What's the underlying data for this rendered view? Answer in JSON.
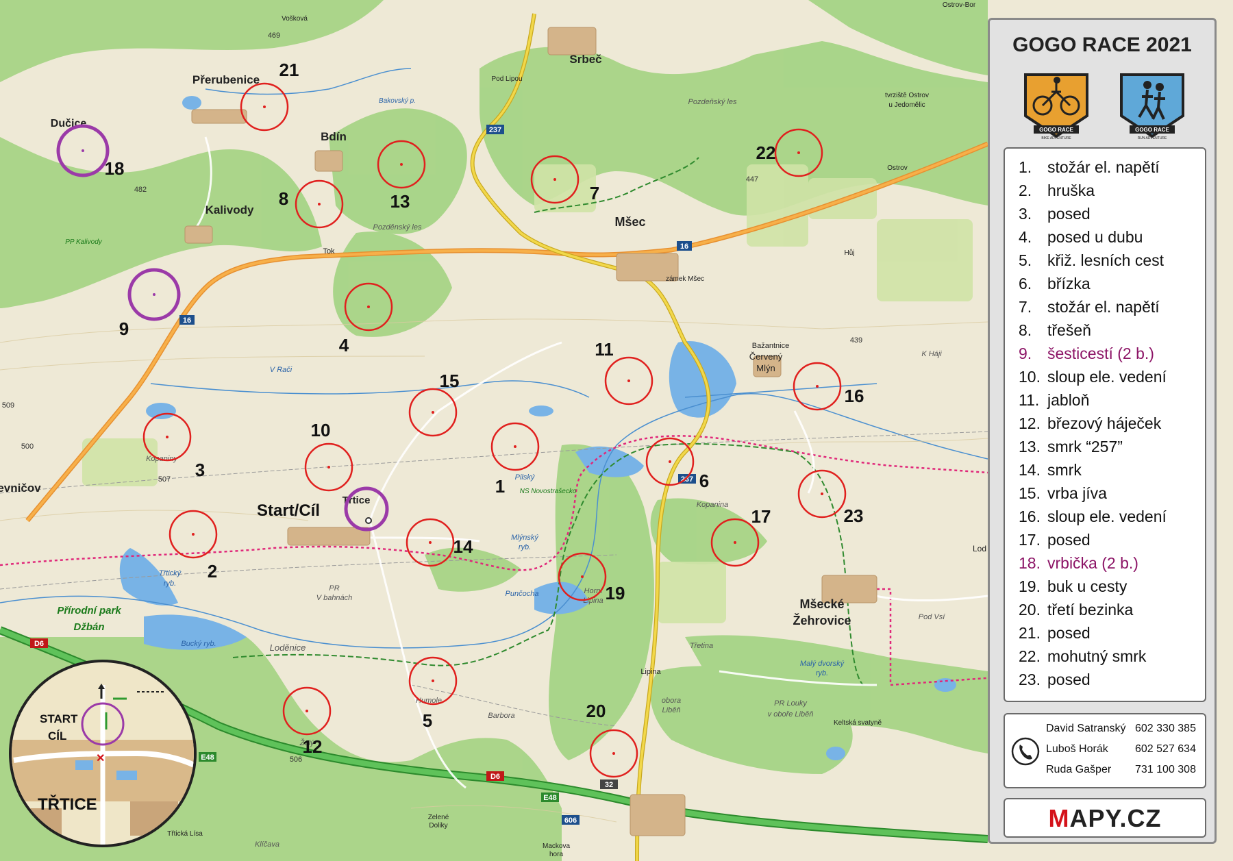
{
  "panel": {
    "title": "GOGO RACE 2021",
    "logo_bike_text": "GOGO RACE",
    "logo_bike_sub": "BIKE ADVENTURE",
    "logo_run_text": "GOGO RACE",
    "logo_run_sub": "RUN ADVENTURE",
    "legend": [
      {
        "num": "1.",
        "label": "stožár el. napětí",
        "special": false
      },
      {
        "num": "2.",
        "label": "hruška",
        "special": false
      },
      {
        "num": "3.",
        "label": "posed",
        "special": false
      },
      {
        "num": "4.",
        "label": "posed u dubu",
        "special": false
      },
      {
        "num": "5.",
        "label": "křiž. lesních cest",
        "special": false
      },
      {
        "num": "6.",
        "label": "břízka",
        "special": false
      },
      {
        "num": "7.",
        "label": "stožár el. napětí",
        "special": false
      },
      {
        "num": "8.",
        "label": "třešeň",
        "special": false
      },
      {
        "num": "9.",
        "label": "šesticestí  (2 b.)",
        "special": true
      },
      {
        "num": "10.",
        "label": "sloup ele. vedení",
        "special": false
      },
      {
        "num": "11.",
        "label": "jabloň",
        "special": false
      },
      {
        "num": "12.",
        "label": "březový háječek",
        "special": false
      },
      {
        "num": "13.",
        "label": "smrk “257”",
        "special": false
      },
      {
        "num": "14.",
        "label": "smrk",
        "special": false
      },
      {
        "num": "15.",
        "label": "vrba jíva",
        "special": false
      },
      {
        "num": "16.",
        "label": "sloup ele. vedení",
        "special": false
      },
      {
        "num": "17.",
        "label": "posed",
        "special": false
      },
      {
        "num": "18.",
        "label": "vrbička (2 b.)",
        "special": true
      },
      {
        "num": "19.",
        "label": "buk u cesty",
        "special": false
      },
      {
        "num": "20.",
        "label": "třetí bezinka",
        "special": false
      },
      {
        "num": "21.",
        "label": "posed",
        "special": false
      },
      {
        "num": "22.",
        "label": "mohutný smrk",
        "special": false
      },
      {
        "num": "23.",
        "label": "posed",
        "special": false
      }
    ],
    "contacts": [
      {
        "name": "David Satranský",
        "phone": "602 330 385"
      },
      {
        "name": "Luboš Horák",
        "phone": "602 527 634"
      },
      {
        "name": "Ruda Gašper",
        "phone": "731 100 308"
      }
    ],
    "brand_first": "M",
    "brand_rest": "APY.CZ"
  },
  "colors": {
    "forest": "#9fcf7f",
    "meadow": "#eee9d6",
    "water": "#78b3e6",
    "main_road": "#f5a33a",
    "secondary_road": "#f0d23a",
    "checkpoint": "#e0201e",
    "bonus_checkpoint": "#9b3aa8",
    "bike_route": "#e0287a",
    "hike_route": "#2f8a2e",
    "highway": "#3aa63a"
  },
  "map": {
    "start_label": "Start/Cíl",
    "inset": {
      "start": "START",
      "finish": "CÍL",
      "town": "TŘTICE"
    },
    "checkpoints": [
      {
        "n": "1"
      },
      {
        "n": "2"
      },
      {
        "n": "3"
      },
      {
        "n": "4"
      },
      {
        "n": "5"
      },
      {
        "n": "6"
      },
      {
        "n": "7"
      },
      {
        "n": "8"
      },
      {
        "n": "9",
        "bonus": true
      },
      {
        "n": "10"
      },
      {
        "n": "11"
      },
      {
        "n": "12"
      },
      {
        "n": "13"
      },
      {
        "n": "14"
      },
      {
        "n": "15"
      },
      {
        "n": "16"
      },
      {
        "n": "17"
      },
      {
        "n": "18",
        "bonus": true
      },
      {
        "n": "19"
      },
      {
        "n": "20"
      },
      {
        "n": "21"
      },
      {
        "n": "22"
      },
      {
        "n": "23"
      }
    ],
    "towns": [
      "Srbeč",
      "Přerubenice",
      "Bdín",
      "Dučice",
      "Kalivody",
      "Mšec",
      "Třtice",
      "Mšecké",
      "Žehrovice",
      "Červený",
      "Mlýn",
      "Bažantnice",
      "Kopanina",
      "Lipina",
      "Hůj",
      "Tok",
      "Ostrov",
      "Ostrov-Bor",
      "Loděnice",
      "Bucký ryb.",
      "Přírodní park",
      "Džbán",
      "Třtická Lísa",
      "Zelené",
      "Doliky",
      "Mackova",
      "hora",
      "Horní",
      "Lipina",
      "Kopaniny",
      "Žalý",
      "Pod Vsí",
      "K Háji",
      "Pod Lipou",
      "zámek Mšec",
      "Keltská svatyně",
      "Vošková",
      "Třetina",
      "Barbora",
      "Humole",
      "Mlýnský",
      "ryb.",
      "Pilský",
      "Punčocha",
      "PR Louky",
      "v oboře Liběň",
      "obora",
      "Liběň",
      "PR",
      "V bahnách",
      "Třtický",
      "ryb.",
      "Malý dvorský",
      "ryb.",
      "PP Kalivody",
      "Pozděnský les",
      "Pozdeňský les",
      "tvrziště Ostrov",
      "u Jedomělic",
      "Bakovský p.",
      "V Rači",
      "Klíčava",
      "NS Novostrašecko",
      "evničov",
      "Hůj",
      "Lod"
    ],
    "road_numbers": [
      "237",
      "16",
      "16",
      "237",
      "D6",
      "D6",
      "E48",
      "E48",
      "606",
      "32"
    ],
    "elevations": [
      "469",
      "482",
      "447",
      "439",
      "509",
      "507",
      "506",
      "500"
    ]
  }
}
